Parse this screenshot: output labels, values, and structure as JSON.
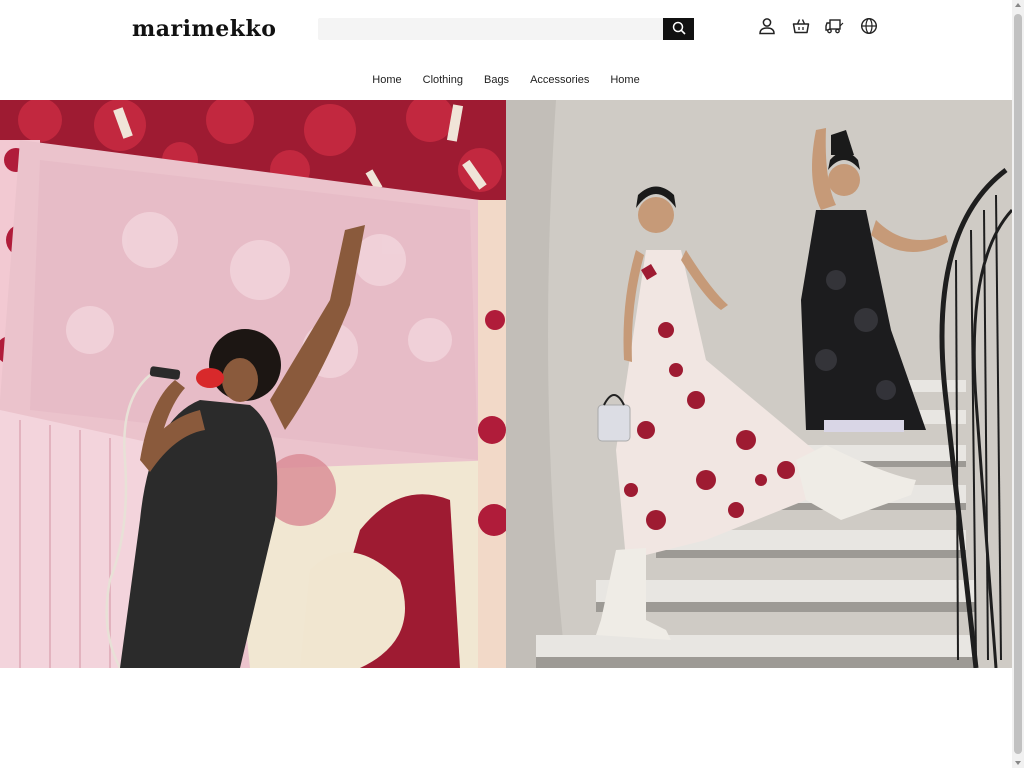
{
  "header": {
    "logo_text": "marimekko",
    "search": {
      "placeholder": "",
      "value": ""
    },
    "icons": [
      "user-icon",
      "shopping-basket-icon",
      "delivery-truck-icon",
      "globe-icon"
    ]
  },
  "nav": {
    "items": [
      "Home",
      "Clothing",
      "Bags",
      "Accessories",
      "Home"
    ]
  },
  "hero": {
    "left_image": "woman-singing-with-red-microphone-floral-backdrop",
    "right_image": "two-women-on-spiral-staircase-floral-dresses"
  },
  "colors": {
    "accent": "#111111",
    "brand_red": "#9e1b32",
    "pink": "#e9c9cf"
  }
}
